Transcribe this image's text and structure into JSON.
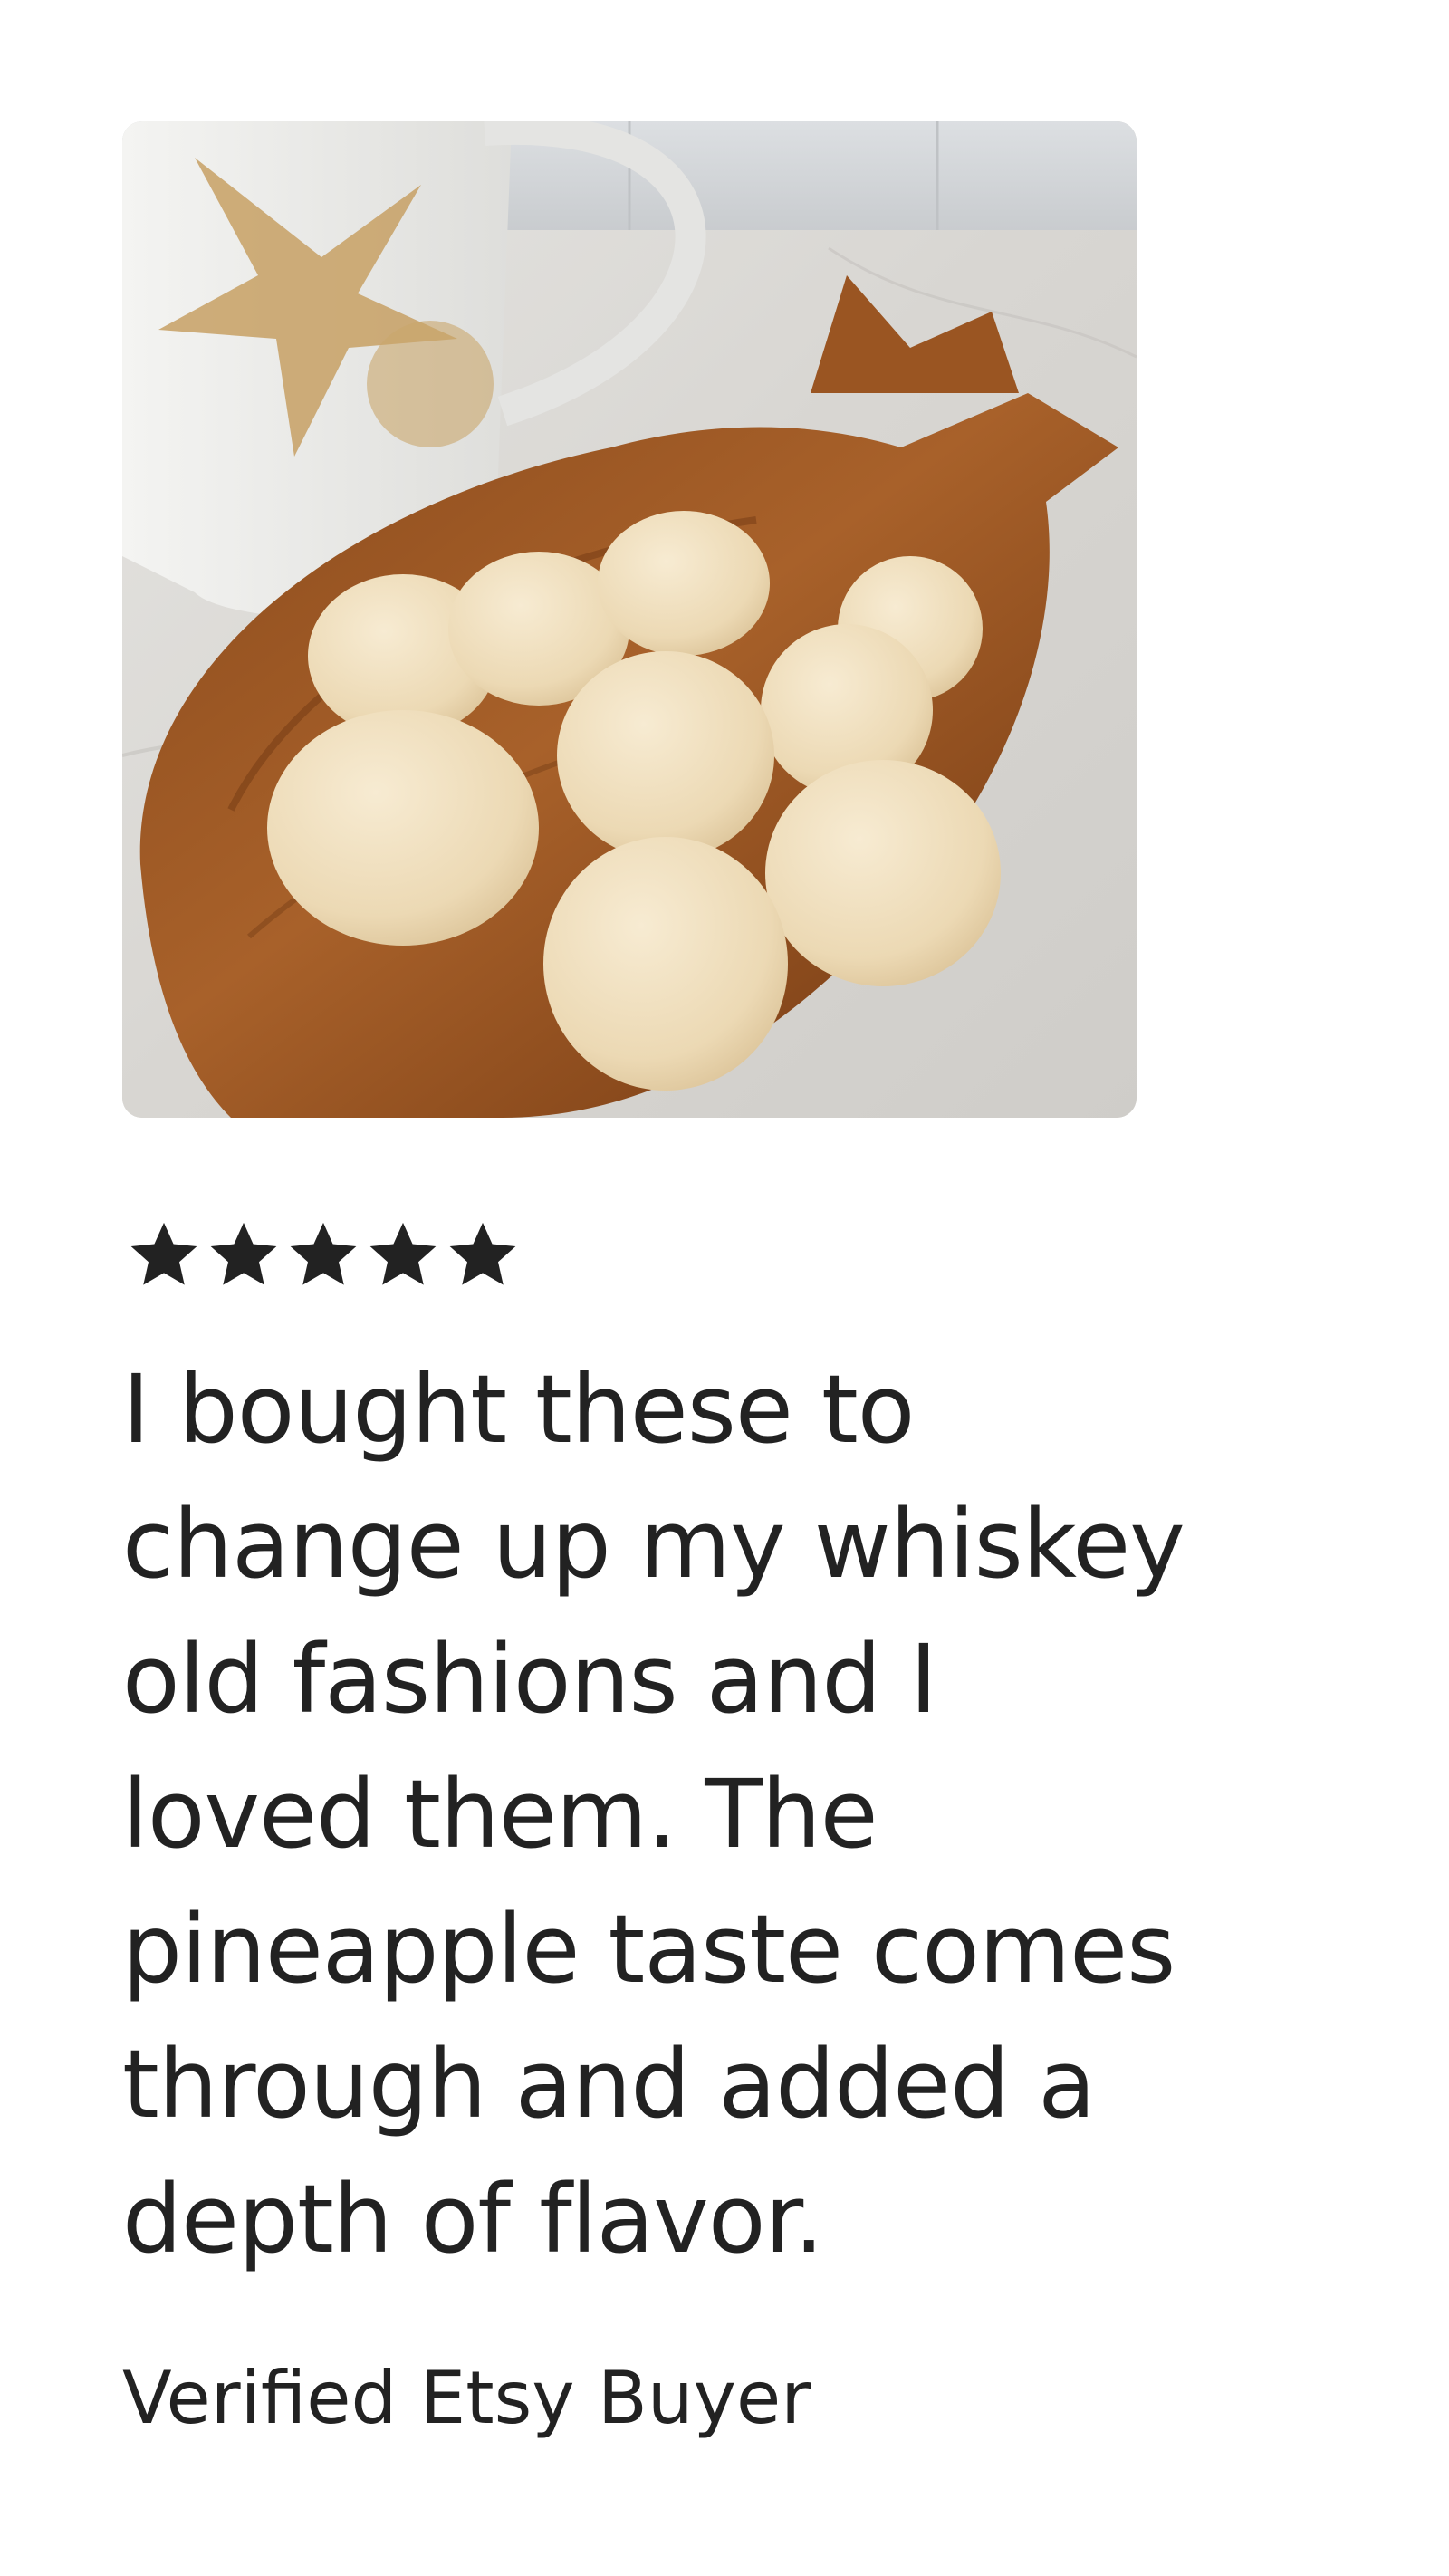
{
  "review": {
    "photo_icon": "review-photo",
    "rating": 5,
    "star_icon": "star-icon",
    "star_color": "#222222",
    "text_lines": [
      "I bought these to",
      "change up my whiskey",
      "old fashions and I",
      "loved them. The",
      "pineapple taste comes",
      "through and added a",
      "depth of flavor."
    ],
    "reviewer": "Verified Etsy Buyer"
  }
}
